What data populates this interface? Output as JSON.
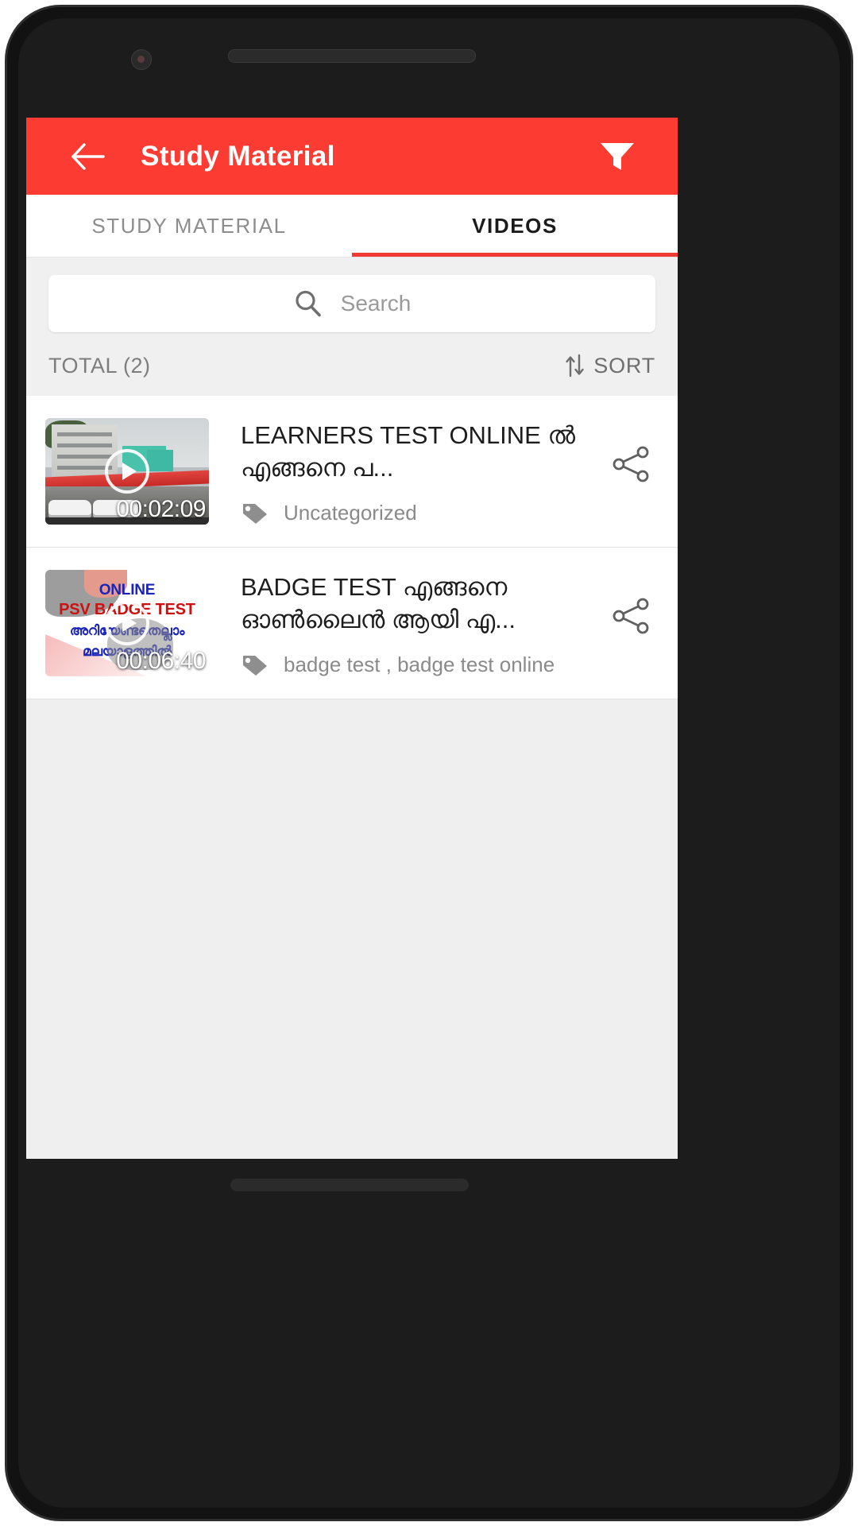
{
  "app": {
    "header": {
      "title": "Study Material",
      "back_icon": "back-arrow-icon",
      "filter_icon": "filter-icon",
      "background_color": "#FC3B33",
      "title_color": "#FFFFFF"
    },
    "tabs": [
      {
        "label": "STUDY MATERIAL",
        "active": false
      },
      {
        "label": "VIDEOS",
        "active": true
      }
    ],
    "tab_indicator_color": "#EF3B33",
    "search": {
      "placeholder": "Search",
      "value": "",
      "icon": "search-icon"
    },
    "summary": {
      "total_label": "TOTAL (2)",
      "sort_label": "SORT",
      "sort_icon": "sort-arrows-icon"
    },
    "list": [
      {
        "title": "LEARNERS TEST ONLINE  ൽ എങ്ങനെ പ...",
        "duration": "00:02:09",
        "tags": "Uncategorized",
        "tag_icon": "tag-icon",
        "share_icon": "share-icon",
        "play_icon": "play-icon",
        "thumbnail_kind": "building-photo"
      },
      {
        "title": "BADGE TEST എങ്ങനെ ഓൺലൈൻ ആയി എ...",
        "duration": "00:06:40",
        "tags": "badge test  , badge test  online",
        "tag_icon": "tag-icon",
        "share_icon": "share-icon",
        "play_icon": "play-icon",
        "thumbnail_kind": "psv-badge-poster",
        "thumbnail_text": {
          "line1": "ONLINE",
          "line2": "PSV BADGE TEST",
          "line3": "അറിയേണ്ടതെല്ലാം",
          "line4": "മലയാളത്തിൽ"
        }
      }
    ]
  }
}
